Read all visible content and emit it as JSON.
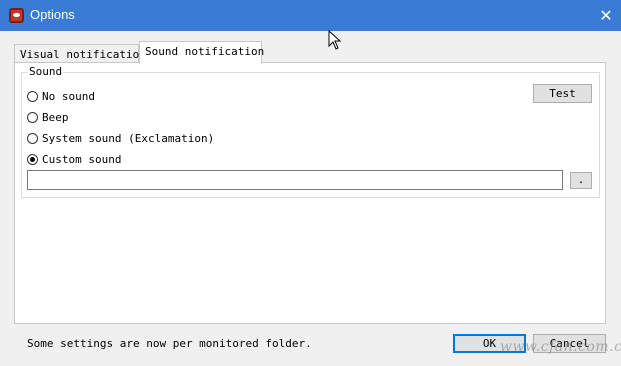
{
  "window": {
    "title": "Options",
    "close_glyph": "✕",
    "icon": "app-eye-icon"
  },
  "tabs": [
    {
      "label": "Visual notification",
      "active": false
    },
    {
      "label": "Sound notification",
      "active": true
    }
  ],
  "sound_group": {
    "label": "Sound",
    "options": [
      {
        "label": "No sound",
        "checked": false
      },
      {
        "label": "Beep",
        "checked": false
      },
      {
        "label": "System sound (Exclamation)",
        "checked": false
      },
      {
        "label": "Custom sound",
        "checked": true
      }
    ],
    "test_button": "Test",
    "custom_path_value": "",
    "browse_button": "."
  },
  "footer": {
    "note": "Some settings are now per monitored folder.",
    "ok_button": "OK",
    "cancel_button": "Cancel"
  },
  "watermark": "www.cfan.com.cn",
  "colors": {
    "titlebar": "#3a7bd5",
    "focus": "#0078d7"
  }
}
